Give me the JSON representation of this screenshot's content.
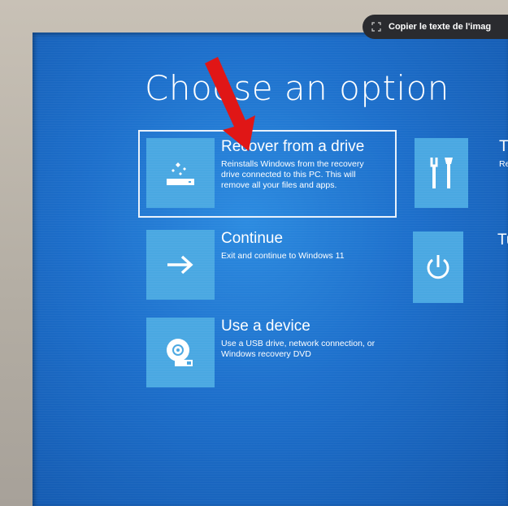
{
  "screen": {
    "title": "Choose an option",
    "options": [
      {
        "name": "Recover from a drive",
        "desc": "Reinstalls Windows from the recovery drive connected to this PC. This will remove all your files and apps.",
        "icon": "drive-recover-icon"
      },
      {
        "name": "Continue",
        "desc": "Exit and continue to Windows 11",
        "icon": "arrow-right-icon"
      },
      {
        "name": "Use a device",
        "desc": "Use a USB drive, network connection, or Windows recovery DVD",
        "icon": "disc-device-icon"
      },
      {
        "name": "T",
        "desc": "Re",
        "icon": "wrench-screwdriver-icon"
      },
      {
        "name": "Tu",
        "desc": "",
        "icon": "power-icon"
      }
    ]
  },
  "overlay": {
    "chip_label": "Copier le texte de l'imag"
  },
  "colors": {
    "screen_blue": "#1d6fcb",
    "tile_blue": "#4aa8e2",
    "annotation_red": "#e01616"
  }
}
